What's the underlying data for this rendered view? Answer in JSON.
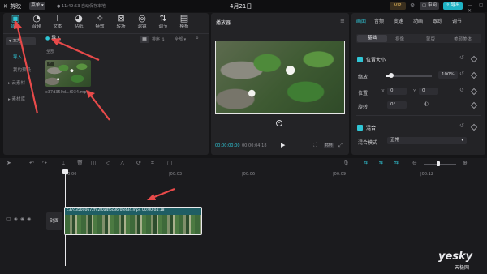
{
  "titlebar": {
    "logo_text": "剪映",
    "menu_label": "菜单",
    "autosave": "11:49:53 自动保存本地",
    "project_date": "4月21日",
    "vip_label": "VIP",
    "share_label": "审阅",
    "export_label": "导出"
  },
  "toolbar": {
    "tools": [
      {
        "label": "媒体",
        "icon": "media-icon"
      },
      {
        "label": "音频",
        "icon": "audio-icon"
      },
      {
        "label": "文本",
        "icon": "text-icon"
      },
      {
        "label": "贴纸",
        "icon": "sticker-icon"
      },
      {
        "label": "特效",
        "icon": "effects-icon"
      },
      {
        "label": "转场",
        "icon": "transition-icon"
      },
      {
        "label": "滤镜",
        "icon": "filter-icon"
      },
      {
        "label": "调节",
        "icon": "adjust-icon"
      },
      {
        "label": "模板",
        "icon": "template-icon"
      }
    ]
  },
  "media_panel": {
    "side_items": [
      "本地",
      "导入",
      "我的预设",
      "云素材",
      "素材库"
    ],
    "import_button": "导入",
    "filter_all": "全部",
    "sort_label": "排序",
    "all_label": "全部",
    "clip_name": "c37d350d...f034.mp4"
  },
  "player": {
    "title": "播放器",
    "time_current": "00:00:00:00",
    "time_total": "00:00:04:18",
    "ratio_label": "比例"
  },
  "inspector": {
    "tabs": [
      "画面",
      "音频",
      "变速",
      "动画",
      "跟踪",
      "调节"
    ],
    "sub_tabs": [
      "基础",
      "抠像",
      "蒙版",
      "美颜美体"
    ],
    "section_position": "位置大小",
    "scale_label": "缩放",
    "scale_value": "100%",
    "position_label": "位置",
    "pos_x": "0",
    "pos_y": "0",
    "pos_x_axis": "X",
    "pos_y_axis": "Y",
    "rotate_label": "旋转",
    "rotate_value": "0°",
    "section_blend": "混合",
    "blend_mode_label": "混合模式",
    "blend_mode_value": "正常"
  },
  "timeline": {
    "ruler": [
      "00:00",
      "|00:03",
      "|00:06",
      "|00:09",
      "|00:12"
    ],
    "cover_label": "封面",
    "clip_title": "c37d350d0672f92f0a4f6c36f0fef34.mp4  00:00:04:18"
  },
  "watermark": {
    "brand": "yesky",
    "cn": "天极网"
  }
}
